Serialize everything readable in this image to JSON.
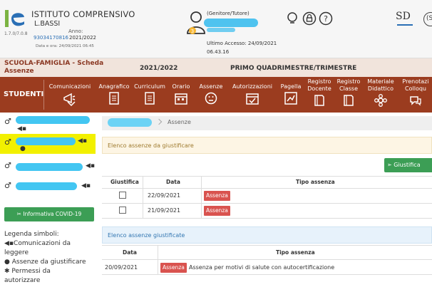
{
  "header": {
    "school_name": "ISTITUTO COMPRENSIVO",
    "school_sub": "L.BASSI",
    "version": "1.7.0/7.0.8",
    "anno_label": "Anno:",
    "code": "93034170816",
    "year": "2021/2022",
    "datetime": "Data e ora: 24/09/2021 06:45",
    "user_badge": "3",
    "role": "(Genitore/Tutore)",
    "last_access_label": "Ultimo Accesso: 24/09/2021",
    "last_access_time": "06.43.16",
    "brand_logo": "SD",
    "brand_circle": "(S",
    "colors": {
      "accent": "#9b3c1f",
      "strip": "#f1e4dc",
      "highlight": "#f2f000",
      "blur": "#43c6f2"
    }
  },
  "strip": {
    "title": "SCUOLA-FAMIGLIA - Scheda Assenze",
    "year": "2021/2022",
    "period": "PRIMO QUADRIMESTRE/TRIMESTRE"
  },
  "menu": {
    "studenti": "STUDENTI",
    "items": [
      {
        "l1": "",
        "l2": "Comunicazioni",
        "icon": "megaphone-icon"
      },
      {
        "l1": "",
        "l2": "Anagrafico",
        "icon": "document-icon"
      },
      {
        "l1": "",
        "l2": "Curriculum",
        "icon": "document-icon"
      },
      {
        "l1": "",
        "l2": "Orario",
        "icon": "calendar-icon"
      },
      {
        "l1": "",
        "l2": "Assenze",
        "icon": "smiley-icon"
      },
      {
        "l1": "",
        "l2": "Autorizzazioni",
        "icon": "calendar-check-icon"
      },
      {
        "l1": "",
        "l2": "Pagella",
        "icon": "report-icon"
      },
      {
        "l1": "Registro",
        "l2": "Docente",
        "icon": "book-icon"
      },
      {
        "l1": "Registro",
        "l2": "Classe",
        "icon": "book-icon"
      },
      {
        "l1": "Materiale",
        "l2": "Didattico",
        "icon": "gear-flower-icon"
      },
      {
        "l1": "Prenotazi",
        "l2": "Colloqu",
        "icon": "speech-icon"
      }
    ]
  },
  "sidebar": {
    "covid_button": "Informativa COVID-19",
    "legend_title": "Legenda simboli:",
    "legend_comunicazioni": "Comunicazioni da",
    "legend_leggere": "leggere",
    "legend_assenze": "Assenze da giustificare",
    "legend_permessi": "Permessi da",
    "legend_autorizzare": "autorizzare"
  },
  "breadcrumb": {
    "label": "Assenze"
  },
  "da_giustificare": {
    "title": "Elenco assenze da giustificare",
    "button": "Giustifica",
    "headers": [
      "Giustifica",
      "Data",
      "Tipo assenza"
    ],
    "rows": [
      {
        "date": "22/09/2021",
        "type": "Assenza"
      },
      {
        "date": "21/09/2021",
        "type": "Assenza"
      }
    ]
  },
  "giustificate": {
    "title": "Elenco assenze giustificate",
    "headers": [
      "Data",
      "Tipo assenza"
    ],
    "rows": [
      {
        "date": "20/09/2021",
        "type": "Assenza",
        "reason": "Assenza per motivi di salute con autocertificazione"
      }
    ]
  }
}
